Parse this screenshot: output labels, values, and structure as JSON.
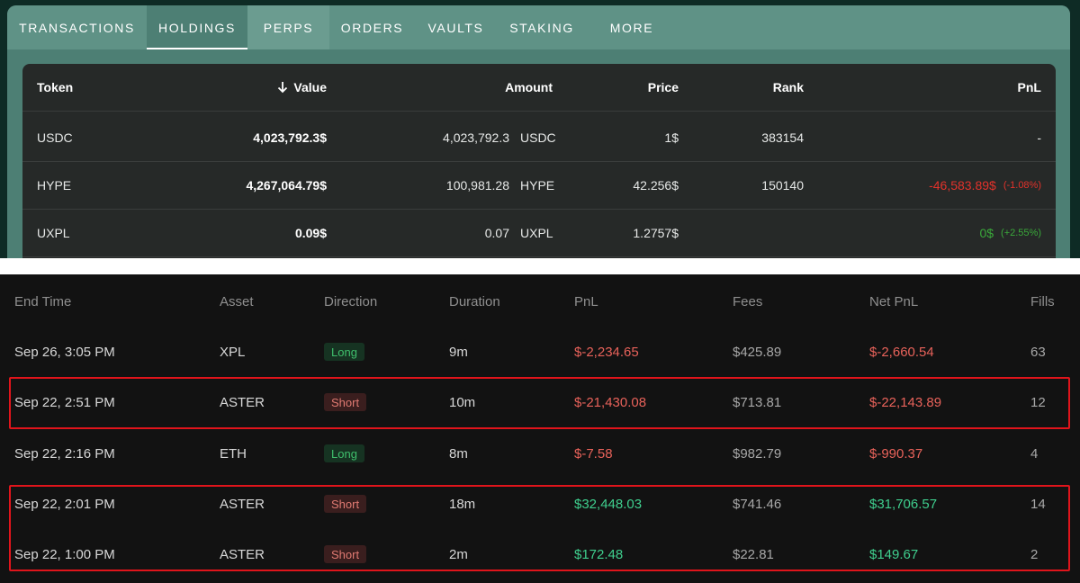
{
  "tabs": [
    {
      "label": "TRANSACTIONS"
    },
    {
      "label": "HOLDINGS"
    },
    {
      "label": "PERPS"
    },
    {
      "label": "ORDERS"
    },
    {
      "label": "VAULTS"
    },
    {
      "label": "STAKING"
    },
    {
      "label": "MORE"
    }
  ],
  "holdings": {
    "headers": {
      "token": "Token",
      "value": "Value",
      "amount": "Amount",
      "price": "Price",
      "rank": "Rank",
      "pnl": "PnL"
    },
    "rows": [
      {
        "token": "USDC",
        "value": "4,023,792.3$",
        "amount": "4,023,792.3",
        "symbol": "USDC",
        "price": "1$",
        "rank": "383154",
        "pnl": "-",
        "pnl_pct": ""
      },
      {
        "token": "HYPE",
        "value": "4,267,064.79$",
        "amount": "100,981.28",
        "symbol": "HYPE",
        "price": "42.256$",
        "rank": "150140",
        "pnl": "-46,583.89$",
        "pnl_pct": "(-1.08%)"
      },
      {
        "token": "UXPL",
        "value": "0.09$",
        "amount": "0.07",
        "symbol": "UXPL",
        "price": "1.2757$",
        "rank": "",
        "pnl": "0$",
        "pnl_pct": "(+2.55%)"
      }
    ]
  },
  "trades": {
    "headers": {
      "end_time": "End Time",
      "asset": "Asset",
      "direction": "Direction",
      "duration": "Duration",
      "pnl": "PnL",
      "fees": "Fees",
      "net_pnl": "Net PnL",
      "fills": "Fills"
    },
    "rows": [
      {
        "end_time": "Sep 26, 3:05 PM",
        "asset": "XPL",
        "direction": "Long",
        "duration": "9m",
        "pnl": "$-2,234.65",
        "fees": "$425.89",
        "net_pnl": "$-2,660.54",
        "fills": "63"
      },
      {
        "end_time": "Sep 22, 2:51 PM",
        "asset": "ASTER",
        "direction": "Short",
        "duration": "10m",
        "pnl": "$-21,430.08",
        "fees": "$713.81",
        "net_pnl": "$-22,143.89",
        "fills": "12"
      },
      {
        "end_time": "Sep 22, 2:16 PM",
        "asset": "ETH",
        "direction": "Long",
        "duration": "8m",
        "pnl": "$-7.58",
        "fees": "$982.79",
        "net_pnl": "$-990.37",
        "fills": "4"
      },
      {
        "end_time": "Sep 22, 2:01 PM",
        "asset": "ASTER",
        "direction": "Short",
        "duration": "18m",
        "pnl": "$32,448.03",
        "fees": "$741.46",
        "net_pnl": "$31,706.57",
        "fills": "14"
      },
      {
        "end_time": "Sep 22, 1:00 PM",
        "asset": "ASTER",
        "direction": "Short",
        "duration": "2m",
        "pnl": "$172.48",
        "fees": "$22.81",
        "net_pnl": "$149.67",
        "fills": "2"
      }
    ]
  },
  "colors": {
    "negative": "#e8625a",
    "positive": "#3fcf8e",
    "highlight": "#e0141b",
    "tab_bar": "#5f9286"
  }
}
